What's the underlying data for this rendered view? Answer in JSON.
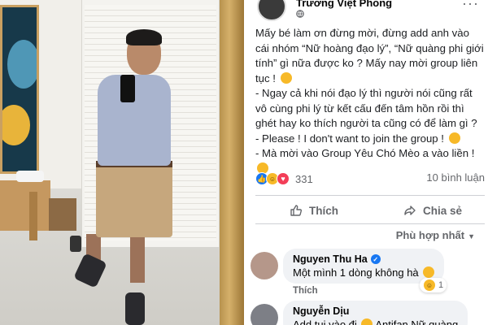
{
  "post": {
    "author": "Trương Việt Phong",
    "meta_icon": "globe-icon",
    "more_label": "···",
    "body": [
      "Mấy bé làm ơn đừng mời, đừng add anh vào cái nhóm “Nữ hoàng đạo lý”, “Nữ quàng phi giới tính” gì nữa được ko ? Mấy nay mời group liên tục !",
      "- Ngay cả khi nói đạo lý thì người nói cũng rất vô cùng phi lý từ kết cấu đến tâm hồn rồi thì ghét hay ko thích người ta cũng có để làm gì ?",
      "- Please ! I don't want to join the group !",
      "- Mà mời vào Group Yêu Chó Mèo a vào liền !"
    ],
    "reaction_count": "331",
    "reaction_icons": [
      "like",
      "haha",
      "love"
    ],
    "comment_count_label": "10 bình luận",
    "like_label": "Thích",
    "share_label": "Chia sẻ",
    "sort_label": "Phù hợp nhất",
    "colors": {
      "like_blue": "#1877f2",
      "haha_yellow": "#f7b928",
      "love_red": "#f33e58"
    }
  },
  "comments": [
    {
      "name": "Nguyen Thu Ha",
      "verified": true,
      "text": "Một mình 1 dòng không hà",
      "reply_label": "Thích",
      "reaction_count": "1"
    },
    {
      "name": "Nguyễn Dịu",
      "verified": false,
      "text": "Add tui vào đi",
      "text_tail": "Antifan Nữ quàng"
    }
  ]
}
